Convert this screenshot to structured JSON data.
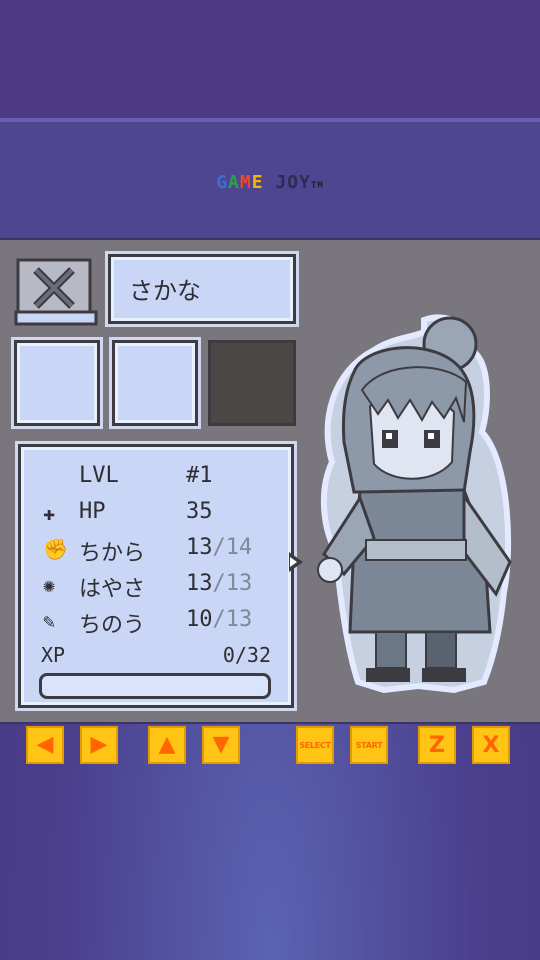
{
  "brand": {
    "letters": [
      {
        "ch": "G",
        "color": "#3b6fd6"
      },
      {
        "ch": "A",
        "color": "#2aa24a"
      },
      {
        "ch": "M",
        "color": "#e84a2a"
      },
      {
        "ch": "E",
        "color": "#f2b705"
      },
      {
        "ch": " ",
        "color": "#000000"
      },
      {
        "ch": "J",
        "color": "#2c2c54"
      },
      {
        "ch": "O",
        "color": "#2c2c54"
      },
      {
        "ch": "Y",
        "color": "#2c2c54"
      }
    ],
    "tm": "TM"
  },
  "character": {
    "name": "さかな",
    "slots": [
      "empty",
      "empty",
      "filled"
    ]
  },
  "stats": {
    "lvl_label": "LVL",
    "lvl_value": "#1",
    "hp_label": "HP",
    "hp_value": "35",
    "str_label": "ちから",
    "str_value": "13",
    "str_max": "/14",
    "spd_label": "はやさ",
    "spd_value": "13",
    "spd_max": "/13",
    "int_label": "ちのう",
    "int_value": "10",
    "int_max": "/13",
    "xp_label": "XP",
    "xp_value": "0/32",
    "xp_progress": 0
  },
  "controls": {
    "left": "◀",
    "right": "▶",
    "up": "▲",
    "down": "▼",
    "select": "SELECT",
    "start": "START",
    "z": "Z",
    "x": "X"
  },
  "colors": {
    "screen_bg": "#7a767d",
    "panel_bg": "#c9d6f5",
    "button_bg": "#ffc414",
    "button_fg": "#ff6600"
  }
}
